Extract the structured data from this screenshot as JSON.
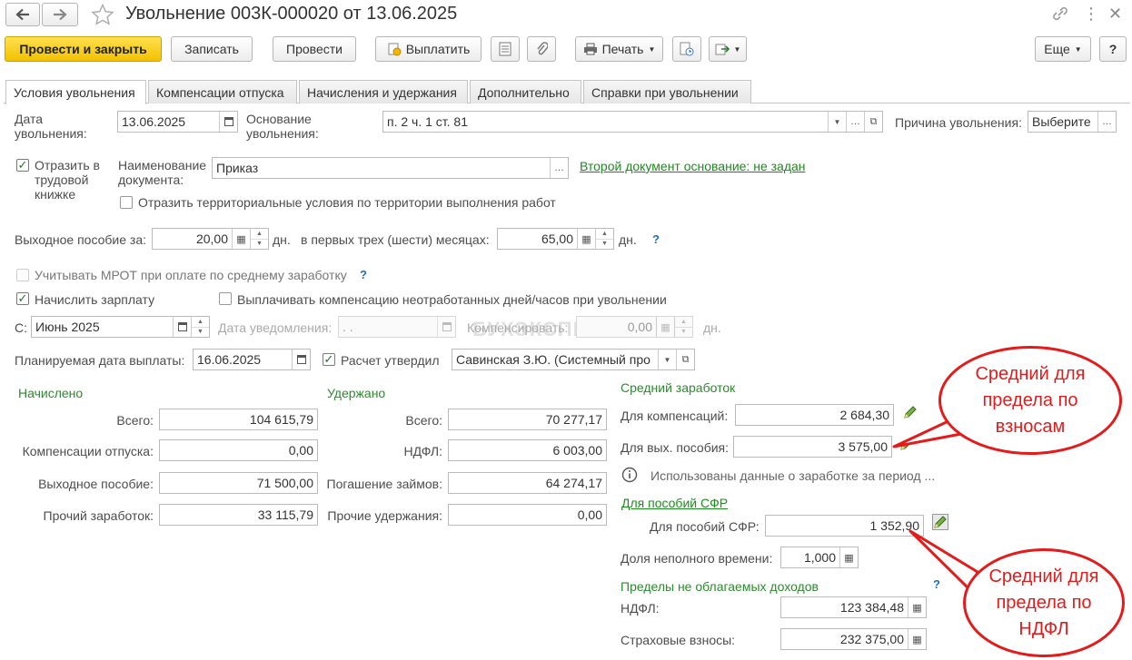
{
  "window": {
    "title": "Увольнение 003К-000020 от 13.06.2025"
  },
  "toolbar": {
    "post_close": "Провести и закрыть",
    "save": "Записать",
    "post": "Провести",
    "pay": "Выплатить",
    "print": "Печать",
    "more": "Еще",
    "help": "?"
  },
  "tabs": [
    "Условия увольнения",
    "Компенсации отпуска",
    "Начисления и удержания",
    "Дополнительно",
    "Справки при увольнении"
  ],
  "form": {
    "dismiss_date_label": "Дата\nувольнения:",
    "dismiss_date": "13.06.2025",
    "basis_label": "Основание\nувольнения:",
    "basis": "п. 2 ч. 1 ст. 81",
    "reason_label": "Причина увольнения:",
    "reason": "Выберите",
    "reflect_label": "Отразить в\nтрудовой\nкнижке",
    "doc_name_label": "Наименование\nдокумента:",
    "doc_name": "Приказ",
    "second_doc_link": "Второй документ основание: не задан",
    "territorial_label": "Отразить территориальные условия по территории выполнения работ",
    "severance_label": "Выходное пособие за:",
    "severance_days": "20,00",
    "days_unit": "дн.",
    "first_months_label": "в первых трех (шести) месяцах:",
    "first_months_days": "65,00",
    "mrot_label": "Учитывать МРОТ при оплате по среднему заработку",
    "accrue_salary_label": "Начислить зарплату",
    "pay_comp_label": "Выплачивать компенсацию неотработанных дней/часов при увольнении",
    "from_label": "С:",
    "from_value": "Июнь 2025",
    "notice_date_label": "Дата уведомления:",
    "notice_date": " .  .",
    "compensate_label": "Компенсировать:",
    "compensate_value": "0,00",
    "planned_pay_label": "Планируемая дата выплаты:",
    "planned_pay_date": "16.06.2025",
    "calc_approved_label": "Расчет утвердил",
    "calc_approved_by": "Савинская З.Ю. (Системный про",
    "question": "?"
  },
  "accrued": {
    "title": "Начислено",
    "rows": [
      {
        "label": "Всего:",
        "value": "104 615,79"
      },
      {
        "label": "Компенсации отпуска:",
        "value": "0,00"
      },
      {
        "label": "Выходное пособие:",
        "value": "71 500,00"
      },
      {
        "label": "Прочий заработок:",
        "value": "33 115,79"
      }
    ]
  },
  "withheld": {
    "title": "Удержано",
    "rows": [
      {
        "label": "Всего:",
        "value": "70 277,17"
      },
      {
        "label": "НДФЛ:",
        "value": "6 003,00"
      },
      {
        "label": "Погашение займов:",
        "value": "64 274,17"
      },
      {
        "label": "Прочие удержания:",
        "value": "0,00"
      }
    ]
  },
  "avg": {
    "title": "Средний заработок",
    "comp_label": "Для компенсаций:",
    "comp_value": "2 684,30",
    "sev_label": "Для вых. пособия:",
    "sev_value": "3 575,00",
    "info_text": "Использованы данные о заработке за период ...",
    "sfr_link": "Для пособий СФР",
    "sfr_label": "Для пособий СФР:",
    "sfr_value": "1 352,90",
    "part_time_label": "Доля неполного времени:",
    "part_time_value": "1,000"
  },
  "limits": {
    "title": "Пределы не облагаемых доходов",
    "ndfl_label": "НДФЛ:",
    "ndfl_value": "123 384,48",
    "ins_label": "Страховые взносы:",
    "ins_value": "232 375,00"
  },
  "annotations": {
    "callout1": "Средний для\nпредела по\nвзносам",
    "callout2": "Средний для\nпредела по\nНДФЛ"
  },
  "watermark": "БУХЭКСПЕРТ",
  "colors": {
    "accent_yellow": "#f5c800",
    "annotation_red": "#e31b1b",
    "group_green": "#2d8a2d"
  }
}
